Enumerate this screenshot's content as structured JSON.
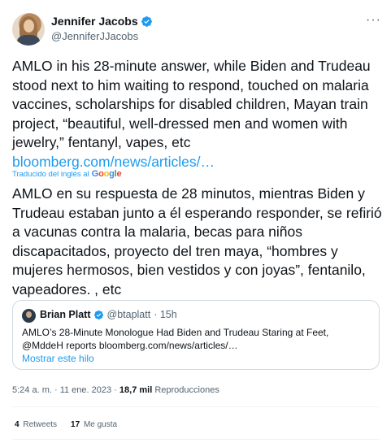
{
  "author": {
    "name": "Jennifer Jacobs",
    "handle": "@JenniferJJacobs"
  },
  "more_glyph": "···",
  "tweet": {
    "text_en": "AMLO in his 28-minute answer, while Biden and Trudeau stood next to him waiting to respond, touched on malaria vaccines, scholarships for disabled children, Mayan train project, “beautiful, well-dressed men and women with jewelry,” fentanyl, vapes, etc",
    "link": "bloomberg.com/news/articles/…",
    "translated_label": "Traducido del inglés al",
    "translate_provider": "Google",
    "text_es": "AMLO en su respuesta de 28 minutos, mientras Biden y Trudeau estaban junto a él esperando responder, se refirió a vacunas contra la malaria, becas para niños discapacitados, proyecto del tren maya, “hombres y mujeres hermosos, bien vestidos y con joyas”, fentanilo, vapeadores. , etc"
  },
  "quote": {
    "name": "Brian Platt",
    "handle": "@btaplatt",
    "time": "· 15h",
    "text": "AMLO’s 28-Minute Monologue Had Biden and Trudeau Staring at Feet, @MddeH reports bloomberg.com/news/articles/…",
    "thread_link": "Mostrar este hilo"
  },
  "meta": {
    "time": "5:24 a. m.",
    "date": "· 11 ene. 2023 ·",
    "views_count": "18,7 mil",
    "views_label": "Reproducciones"
  },
  "stats": {
    "retweets_count": "4",
    "retweets_label": "Retweets",
    "likes_count": "17",
    "likes_label": "Me gusta"
  },
  "colors": {
    "accent": "#1d9bf0",
    "text": "#0f1419",
    "secondary": "#536471",
    "border": "#cfd9de"
  }
}
